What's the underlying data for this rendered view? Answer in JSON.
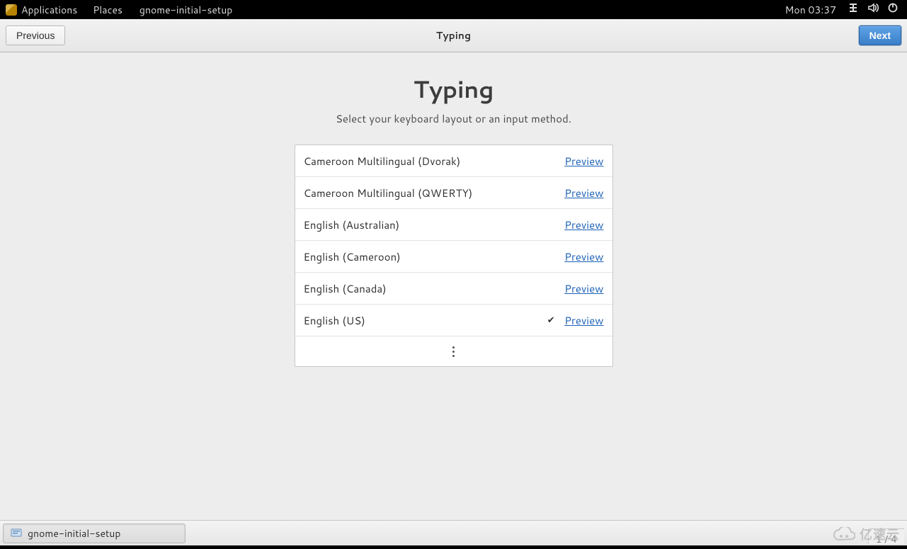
{
  "panel": {
    "applications": "Applications",
    "places": "Places",
    "active_app": "gnome-initial-setup",
    "clock": "Mon 03:37"
  },
  "headerbar": {
    "previous": "Previous",
    "title": "Typing",
    "next": "Next"
  },
  "page": {
    "heading": "Typing",
    "subtitle": "Select your keyboard layout or an input method."
  },
  "layouts": [
    {
      "label": "Cameroon Multilingual (Dvorak)",
      "preview": "Preview",
      "selected": false
    },
    {
      "label": "Cameroon Multilingual (QWERTY)",
      "preview": "Preview",
      "selected": false
    },
    {
      "label": "English (Australian)",
      "preview": "Preview",
      "selected": false
    },
    {
      "label": "English (Cameroon)",
      "preview": "Preview",
      "selected": false
    },
    {
      "label": "English (Canada)",
      "preview": "Preview",
      "selected": false
    },
    {
      "label": "English (US)",
      "preview": "Preview",
      "selected": true
    }
  ],
  "taskbar": {
    "task": "gnome-initial-setup",
    "page_indicator": "1 / 4"
  },
  "watermark": "亿速云"
}
